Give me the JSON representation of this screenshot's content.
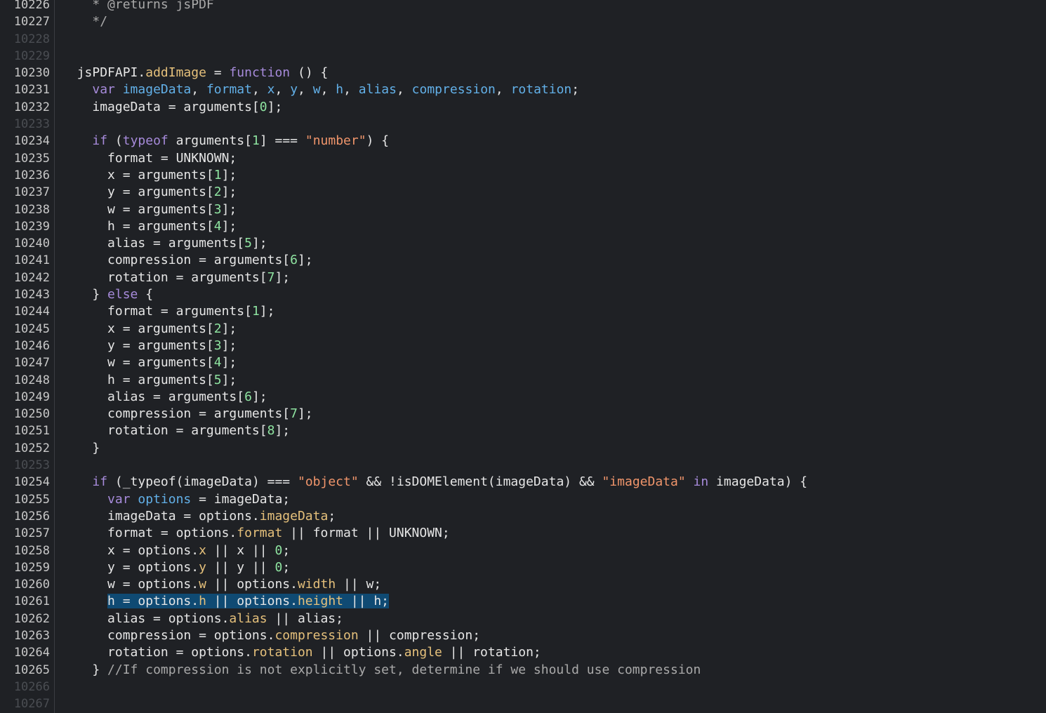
{
  "lines": [
    {
      "n": "10226",
      "indent": "    ",
      "tokens": [
        {
          "t": "* @returns jsPDF",
          "k": "comment"
        }
      ]
    },
    {
      "n": "10227",
      "indent": "    ",
      "tokens": [
        {
          "t": "*/",
          "k": "comment"
        }
      ]
    },
    {
      "n": "10228",
      "indent": "",
      "tokens": []
    },
    {
      "n": "10229",
      "indent": "",
      "tokens": []
    },
    {
      "n": "10230",
      "indent": "  ",
      "tokens": [
        {
          "t": "jsPDFAPI.",
          "k": "plain"
        },
        {
          "t": "addImage",
          "k": "func"
        },
        {
          "t": " = ",
          "k": "plain"
        },
        {
          "t": "function",
          "k": "keyword"
        },
        {
          "t": " () {",
          "k": "plain"
        }
      ]
    },
    {
      "n": "10231",
      "indent": "    ",
      "tokens": [
        {
          "t": "var ",
          "k": "keyword"
        },
        {
          "t": "imageData",
          "k": "var"
        },
        {
          "t": ", ",
          "k": "plain"
        },
        {
          "t": "format",
          "k": "var"
        },
        {
          "t": ", ",
          "k": "plain"
        },
        {
          "t": "x",
          "k": "var"
        },
        {
          "t": ", ",
          "k": "plain"
        },
        {
          "t": "y",
          "k": "var"
        },
        {
          "t": ", ",
          "k": "plain"
        },
        {
          "t": "w",
          "k": "var"
        },
        {
          "t": ", ",
          "k": "plain"
        },
        {
          "t": "h",
          "k": "var"
        },
        {
          "t": ", ",
          "k": "plain"
        },
        {
          "t": "alias",
          "k": "var"
        },
        {
          "t": ", ",
          "k": "plain"
        },
        {
          "t": "compression",
          "k": "var"
        },
        {
          "t": ", ",
          "k": "plain"
        },
        {
          "t": "rotation",
          "k": "var"
        },
        {
          "t": ";",
          "k": "plain"
        }
      ]
    },
    {
      "n": "10232",
      "indent": "    ",
      "tokens": [
        {
          "t": "imageData = arguments[",
          "k": "plain"
        },
        {
          "t": "0",
          "k": "number"
        },
        {
          "t": "];",
          "k": "plain"
        }
      ]
    },
    {
      "n": "10233",
      "indent": "",
      "tokens": []
    },
    {
      "n": "10234",
      "indent": "    ",
      "tokens": [
        {
          "t": "if",
          "k": "keyword"
        },
        {
          "t": " (",
          "k": "plain"
        },
        {
          "t": "typeof",
          "k": "keyword"
        },
        {
          "t": " arguments[",
          "k": "plain"
        },
        {
          "t": "1",
          "k": "number"
        },
        {
          "t": "] === ",
          "k": "plain"
        },
        {
          "t": "\"number\"",
          "k": "string"
        },
        {
          "t": ") {",
          "k": "plain"
        }
      ]
    },
    {
      "n": "10235",
      "indent": "      ",
      "tokens": [
        {
          "t": "format = UNKNOWN;",
          "k": "plain"
        }
      ]
    },
    {
      "n": "10236",
      "indent": "      ",
      "tokens": [
        {
          "t": "x = arguments[",
          "k": "plain"
        },
        {
          "t": "1",
          "k": "number"
        },
        {
          "t": "];",
          "k": "plain"
        }
      ]
    },
    {
      "n": "10237",
      "indent": "      ",
      "tokens": [
        {
          "t": "y = arguments[",
          "k": "plain"
        },
        {
          "t": "2",
          "k": "number"
        },
        {
          "t": "];",
          "k": "plain"
        }
      ]
    },
    {
      "n": "10238",
      "indent": "      ",
      "tokens": [
        {
          "t": "w = arguments[",
          "k": "plain"
        },
        {
          "t": "3",
          "k": "number"
        },
        {
          "t": "];",
          "k": "plain"
        }
      ]
    },
    {
      "n": "10239",
      "indent": "      ",
      "tokens": [
        {
          "t": "h = arguments[",
          "k": "plain"
        },
        {
          "t": "4",
          "k": "number"
        },
        {
          "t": "];",
          "k": "plain"
        }
      ]
    },
    {
      "n": "10240",
      "indent": "      ",
      "tokens": [
        {
          "t": "alias = arguments[",
          "k": "plain"
        },
        {
          "t": "5",
          "k": "number"
        },
        {
          "t": "];",
          "k": "plain"
        }
      ]
    },
    {
      "n": "10241",
      "indent": "      ",
      "tokens": [
        {
          "t": "compression = arguments[",
          "k": "plain"
        },
        {
          "t": "6",
          "k": "number"
        },
        {
          "t": "];",
          "k": "plain"
        }
      ]
    },
    {
      "n": "10242",
      "indent": "      ",
      "tokens": [
        {
          "t": "rotation = arguments[",
          "k": "plain"
        },
        {
          "t": "7",
          "k": "number"
        },
        {
          "t": "];",
          "k": "plain"
        }
      ]
    },
    {
      "n": "10243",
      "indent": "    ",
      "tokens": [
        {
          "t": "} ",
          "k": "plain"
        },
        {
          "t": "else",
          "k": "keyword"
        },
        {
          "t": " {",
          "k": "plain"
        }
      ]
    },
    {
      "n": "10244",
      "indent": "      ",
      "tokens": [
        {
          "t": "format = arguments[",
          "k": "plain"
        },
        {
          "t": "1",
          "k": "number"
        },
        {
          "t": "];",
          "k": "plain"
        }
      ]
    },
    {
      "n": "10245",
      "indent": "      ",
      "tokens": [
        {
          "t": "x = arguments[",
          "k": "plain"
        },
        {
          "t": "2",
          "k": "number"
        },
        {
          "t": "];",
          "k": "plain"
        }
      ]
    },
    {
      "n": "10246",
      "indent": "      ",
      "tokens": [
        {
          "t": "y = arguments[",
          "k": "plain"
        },
        {
          "t": "3",
          "k": "number"
        },
        {
          "t": "];",
          "k": "plain"
        }
      ]
    },
    {
      "n": "10247",
      "indent": "      ",
      "tokens": [
        {
          "t": "w = arguments[",
          "k": "plain"
        },
        {
          "t": "4",
          "k": "number"
        },
        {
          "t": "];",
          "k": "plain"
        }
      ]
    },
    {
      "n": "10248",
      "indent": "      ",
      "tokens": [
        {
          "t": "h = arguments[",
          "k": "plain"
        },
        {
          "t": "5",
          "k": "number"
        },
        {
          "t": "];",
          "k": "plain"
        }
      ]
    },
    {
      "n": "10249",
      "indent": "      ",
      "tokens": [
        {
          "t": "alias = arguments[",
          "k": "plain"
        },
        {
          "t": "6",
          "k": "number"
        },
        {
          "t": "];",
          "k": "plain"
        }
      ]
    },
    {
      "n": "10250",
      "indent": "      ",
      "tokens": [
        {
          "t": "compression = arguments[",
          "k": "plain"
        },
        {
          "t": "7",
          "k": "number"
        },
        {
          "t": "];",
          "k": "plain"
        }
      ]
    },
    {
      "n": "10251",
      "indent": "      ",
      "tokens": [
        {
          "t": "rotation = arguments[",
          "k": "plain"
        },
        {
          "t": "8",
          "k": "number"
        },
        {
          "t": "];",
          "k": "plain"
        }
      ]
    },
    {
      "n": "10252",
      "indent": "    ",
      "tokens": [
        {
          "t": "}",
          "k": "plain"
        }
      ]
    },
    {
      "n": "10253",
      "indent": "",
      "tokens": []
    },
    {
      "n": "10254",
      "indent": "    ",
      "tokens": [
        {
          "t": "if",
          "k": "keyword"
        },
        {
          "t": " (_typeof(imageData) === ",
          "k": "plain"
        },
        {
          "t": "\"object\"",
          "k": "string"
        },
        {
          "t": " && !isDOMElement(imageData) && ",
          "k": "plain"
        },
        {
          "t": "\"imageData\"",
          "k": "string"
        },
        {
          "t": " ",
          "k": "plain"
        },
        {
          "t": "in",
          "k": "keyword"
        },
        {
          "t": " imageData) {",
          "k": "plain"
        }
      ]
    },
    {
      "n": "10255",
      "indent": "      ",
      "tokens": [
        {
          "t": "var ",
          "k": "keyword"
        },
        {
          "t": "options",
          "k": "var"
        },
        {
          "t": " = imageData;",
          "k": "plain"
        }
      ]
    },
    {
      "n": "10256",
      "indent": "      ",
      "tokens": [
        {
          "t": "imageData = options.",
          "k": "plain"
        },
        {
          "t": "imageData",
          "k": "prop"
        },
        {
          "t": ";",
          "k": "plain"
        }
      ]
    },
    {
      "n": "10257",
      "indent": "      ",
      "tokens": [
        {
          "t": "format = options.",
          "k": "plain"
        },
        {
          "t": "format",
          "k": "prop"
        },
        {
          "t": " || format || UNKNOWN;",
          "k": "plain"
        }
      ]
    },
    {
      "n": "10258",
      "indent": "      ",
      "tokens": [
        {
          "t": "x = options.",
          "k": "plain"
        },
        {
          "t": "x",
          "k": "prop"
        },
        {
          "t": " || x || ",
          "k": "plain"
        },
        {
          "t": "0",
          "k": "number"
        },
        {
          "t": ";",
          "k": "plain"
        }
      ]
    },
    {
      "n": "10259",
      "indent": "      ",
      "tokens": [
        {
          "t": "y = options.",
          "k": "plain"
        },
        {
          "t": "y",
          "k": "prop"
        },
        {
          "t": " || y || ",
          "k": "plain"
        },
        {
          "t": "0",
          "k": "number"
        },
        {
          "t": ";",
          "k": "plain"
        }
      ]
    },
    {
      "n": "10260",
      "indent": "      ",
      "tokens": [
        {
          "t": "w = options.",
          "k": "plain"
        },
        {
          "t": "w",
          "k": "prop"
        },
        {
          "t": " || options.",
          "k": "plain"
        },
        {
          "t": "width",
          "k": "prop"
        },
        {
          "t": " || w;",
          "k": "plain"
        }
      ]
    },
    {
      "n": "10261",
      "indent": "      ",
      "selected": true,
      "tokens": [
        {
          "t": "h = options.",
          "k": "plain"
        },
        {
          "t": "h",
          "k": "prop"
        },
        {
          "t": " || options.",
          "k": "plain"
        },
        {
          "t": "height",
          "k": "prop"
        },
        {
          "t": " || h;",
          "k": "plain"
        }
      ]
    },
    {
      "n": "10262",
      "indent": "      ",
      "tokens": [
        {
          "t": "alias = options.",
          "k": "plain"
        },
        {
          "t": "alias",
          "k": "prop"
        },
        {
          "t": " || alias;",
          "k": "plain"
        }
      ]
    },
    {
      "n": "10263",
      "indent": "      ",
      "tokens": [
        {
          "t": "compression = options.",
          "k": "plain"
        },
        {
          "t": "compression",
          "k": "prop"
        },
        {
          "t": " || compression;",
          "k": "plain"
        }
      ]
    },
    {
      "n": "10264",
      "indent": "      ",
      "tokens": [
        {
          "t": "rotation = options.",
          "k": "plain"
        },
        {
          "t": "rotation",
          "k": "prop"
        },
        {
          "t": " || options.",
          "k": "plain"
        },
        {
          "t": "angle",
          "k": "prop"
        },
        {
          "t": " || rotation;",
          "k": "plain"
        }
      ]
    },
    {
      "n": "10265",
      "indent": "    ",
      "tokens": [
        {
          "t": "} ",
          "k": "plain"
        },
        {
          "t": "//If compression is not explicitly set, determine if we should use compression",
          "k": "comment"
        }
      ]
    },
    {
      "n": "10266",
      "indent": "",
      "tokens": []
    },
    {
      "n": "10267",
      "indent": "",
      "tokens": []
    }
  ]
}
